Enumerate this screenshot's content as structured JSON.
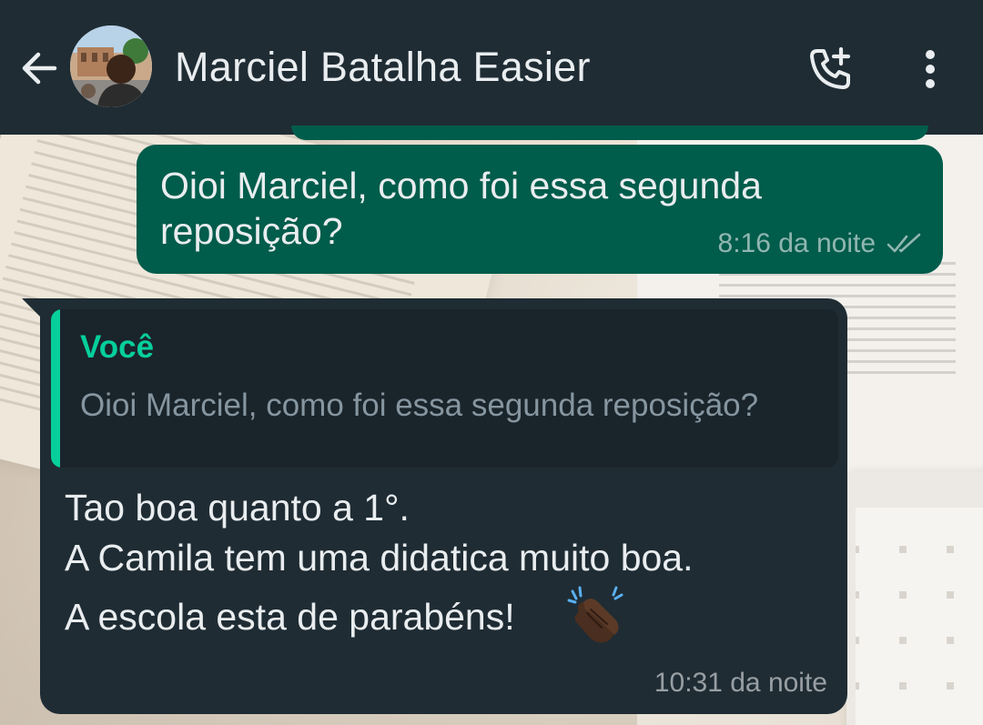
{
  "header": {
    "contact_name": "Marciel Batalha Easier",
    "back_icon": "arrow-left-icon",
    "call_icon": "add-call-icon",
    "menu_icon": "more-vertical-icon",
    "bar_color": "#1f2c34"
  },
  "messages": {
    "outgoing": {
      "text": "Oioi Marciel, como foi essa segunda reposição?",
      "time": "8:16 da noite",
      "status_icon": "double-check-icon",
      "bubble_color": "#005c4b"
    },
    "incoming": {
      "quote": {
        "author": "Você",
        "text": "Oioi Marciel, como foi essa segunda reposição?",
        "accent_color": "#06cf9c"
      },
      "lines": [
        "Tao boa quanto a 1°.",
        "A Camila tem uma didatica muito boa.",
        "A escola esta de parabéns!"
      ],
      "emoji": "clapping-hands-emoji",
      "time": "10:31 da noite",
      "bubble_color": "#1f2c34"
    }
  }
}
